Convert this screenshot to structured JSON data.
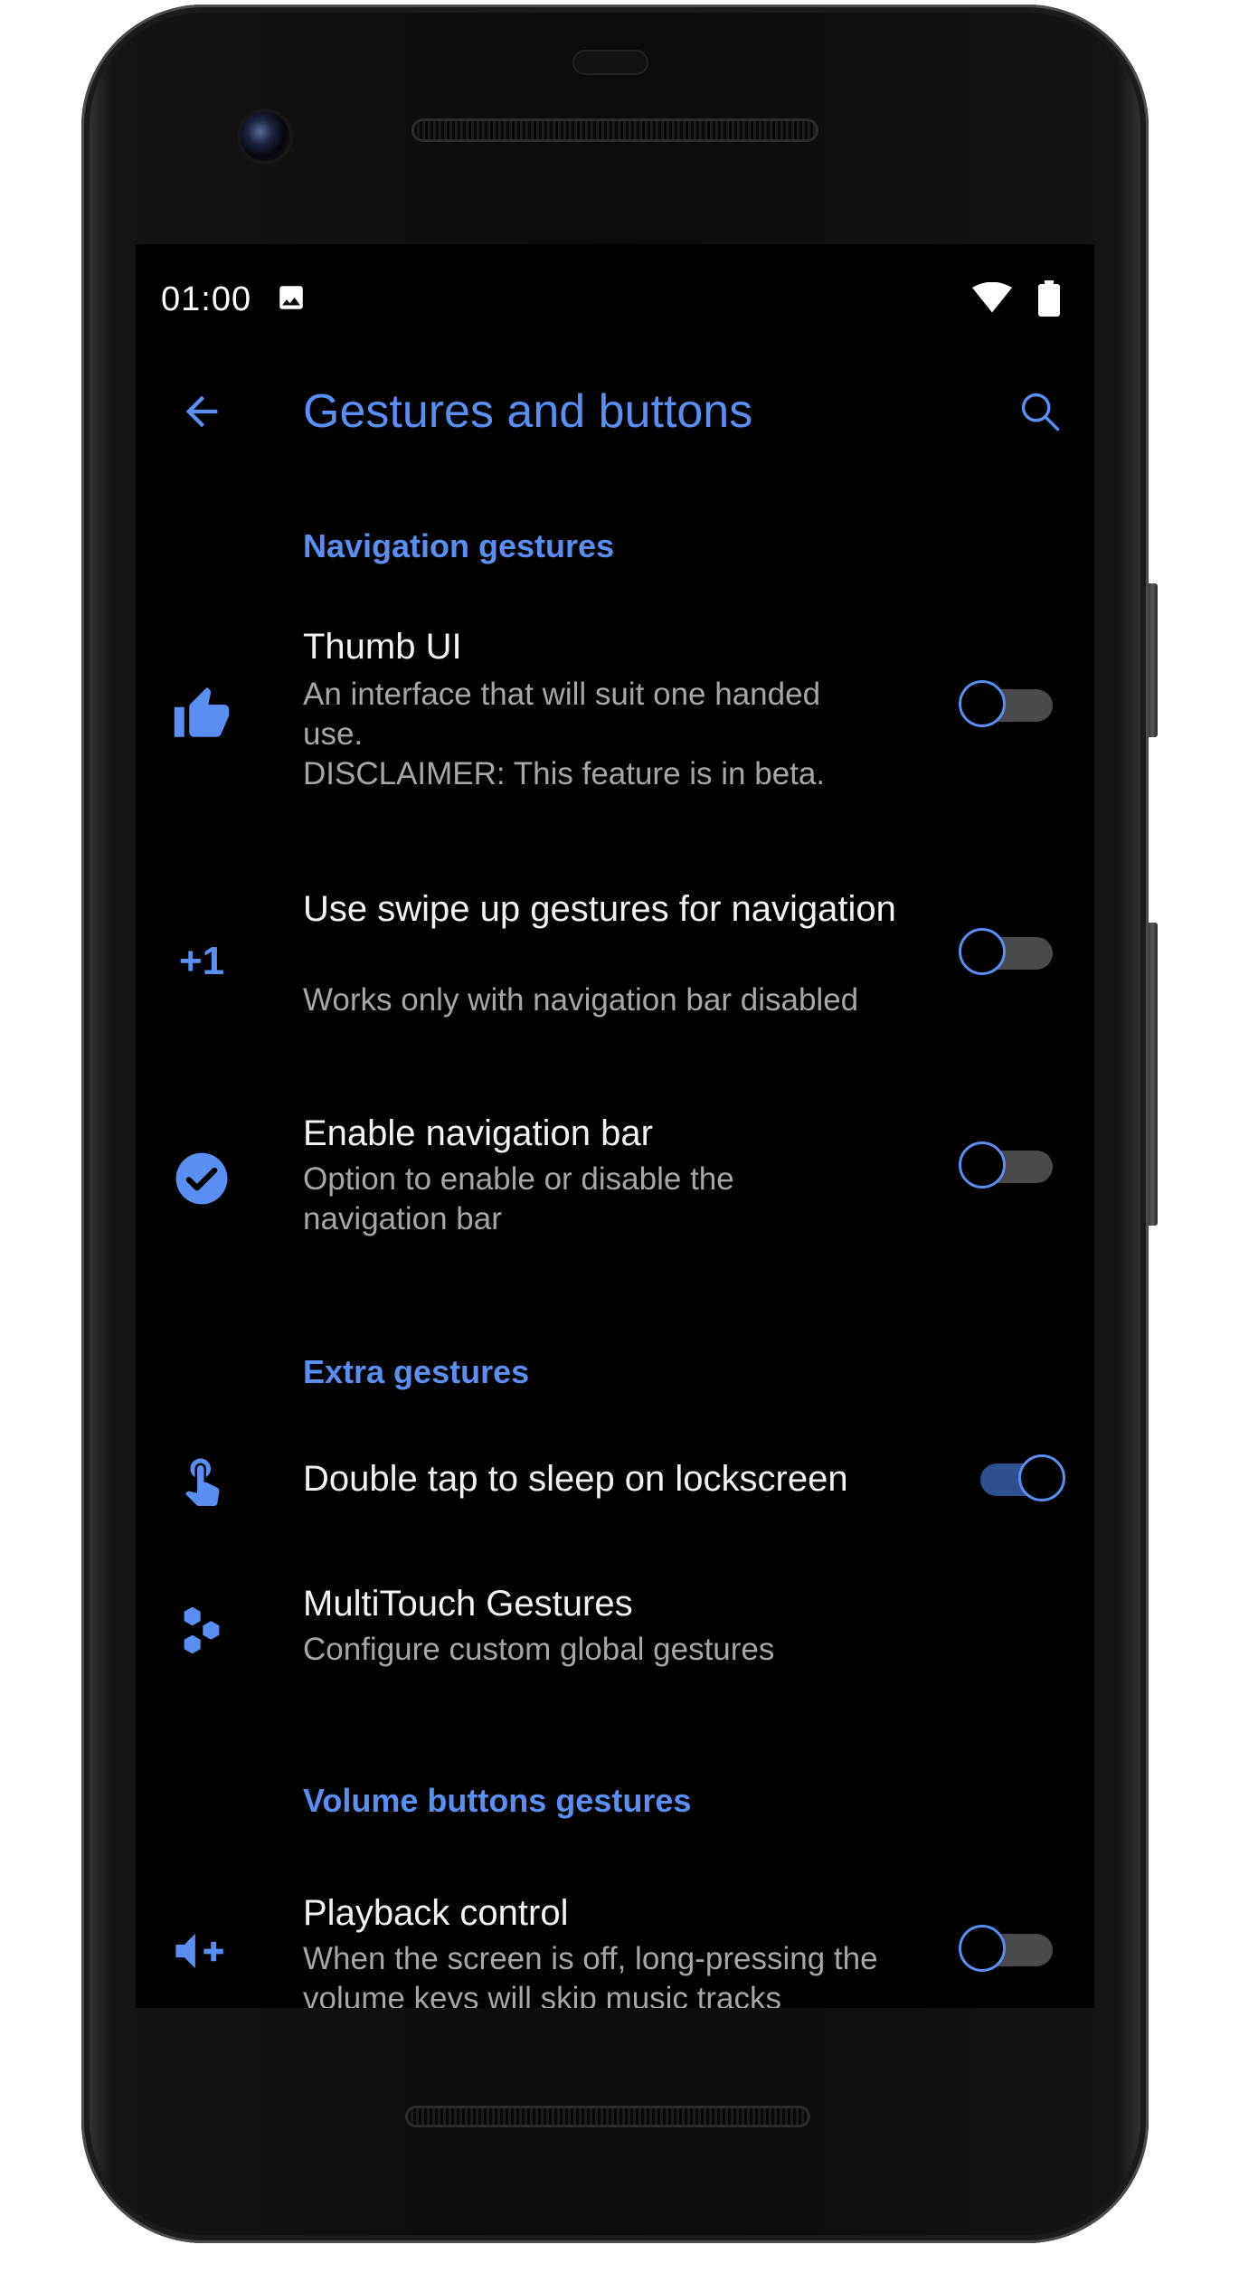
{
  "status_bar": {
    "time": "01:00"
  },
  "app_bar": {
    "title": "Gestures and buttons"
  },
  "sections": [
    {
      "header": "Navigation gestures"
    },
    {
      "header": "Extra gestures"
    },
    {
      "header": "Volume buttons gestures"
    }
  ],
  "items": [
    {
      "title": "Thumb UI",
      "subtitle": "An interface that will suit one handed\nuse.\nDISCLAIMER: This feature is in beta.",
      "toggle": "off",
      "icon": "thumbs-up-icon"
    },
    {
      "title": "Use swipe up gestures for navigation",
      "subtitle": "Works only with navigation bar disabled",
      "toggle": "off",
      "icon": "plus-one-icon",
      "icon_text": "+1"
    },
    {
      "title": "Enable navigation bar",
      "subtitle": "Option to enable or disable the\nnavigation bar",
      "toggle": "off",
      "icon": "check-circle-icon"
    },
    {
      "title": "Double tap to sleep on lockscreen",
      "toggle": "on",
      "icon": "touch-app-icon"
    },
    {
      "title": "MultiTouch Gestures",
      "subtitle": "Configure custom global gestures",
      "icon": "hexagons-icon"
    },
    {
      "title": "Playback control",
      "subtitle": "When the screen is off, long-pressing the\nvolume keys will skip music tracks",
      "toggle": "off",
      "icon": "volume-plus-icon"
    }
  ],
  "colors": {
    "accent": "#5b8ef2",
    "background": "#000000",
    "text": "#f2f2f2",
    "subtext": "#a6a6a6"
  }
}
